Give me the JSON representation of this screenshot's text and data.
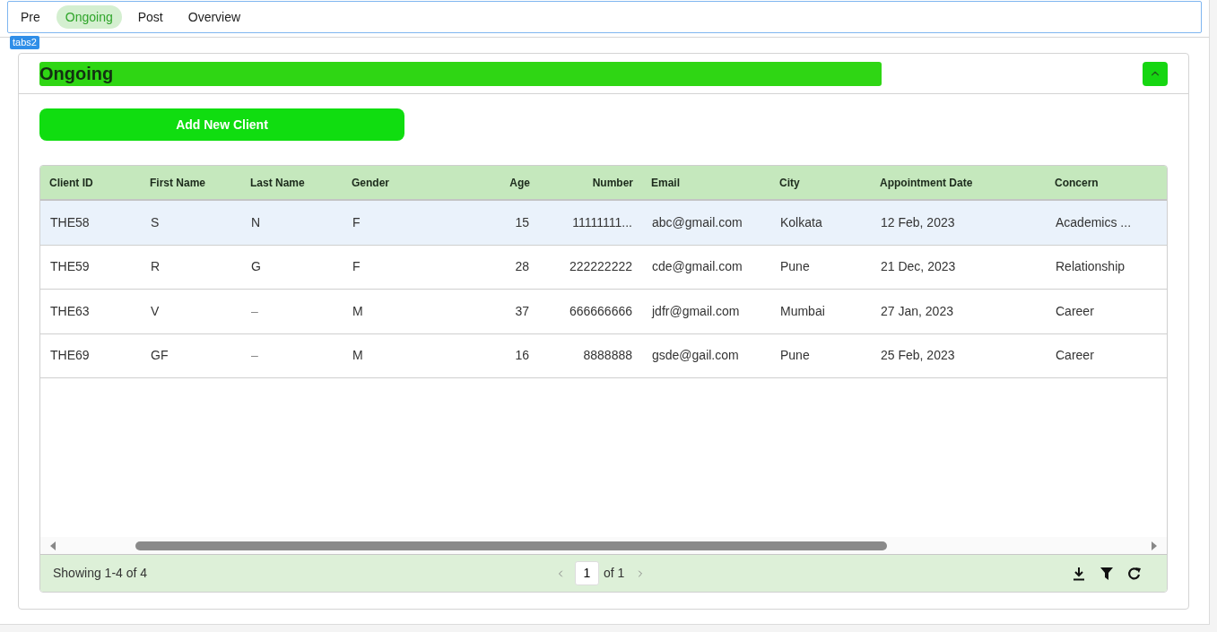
{
  "tabs": [
    {
      "label": "Pre",
      "selected": false
    },
    {
      "label": "Ongoing",
      "selected": true
    },
    {
      "label": "Post",
      "selected": false
    },
    {
      "label": "Overview",
      "selected": false
    }
  ],
  "editor_tag": "tabs2",
  "section": {
    "title": "Ongoing",
    "expanded": true
  },
  "add_button": "Add New Client",
  "table": {
    "columns": [
      {
        "label": "Client ID",
        "kind": "text"
      },
      {
        "label": "First Name",
        "kind": "text"
      },
      {
        "label": "Last Name",
        "kind": "text"
      },
      {
        "label": "Gender",
        "kind": "text"
      },
      {
        "label": "Age",
        "kind": "number"
      },
      {
        "label": "Number",
        "kind": "number"
      },
      {
        "label": "Email",
        "kind": "text"
      },
      {
        "label": "City",
        "kind": "text"
      },
      {
        "label": "Appointment Date",
        "kind": "text"
      },
      {
        "label": "Concern",
        "kind": "text"
      }
    ],
    "rows": [
      {
        "selected": true,
        "cells": [
          "THE58",
          "S",
          "N",
          "F",
          "15",
          "11111111...",
          "abc@gmail.com",
          "Kolkata",
          "12 Feb, 2023",
          "Academics ..."
        ]
      },
      {
        "selected": false,
        "cells": [
          "THE59",
          "R",
          "G",
          "F",
          "28",
          "222222222",
          "cde@gmail.com",
          "Pune",
          "21 Dec, 2023",
          "Relationship"
        ]
      },
      {
        "selected": false,
        "cells": [
          "THE63",
          "V",
          "–",
          "M",
          "37",
          "666666666",
          "jdfr@gmail.com",
          "Mumbai",
          "27 Jan, 2023",
          "Career"
        ]
      },
      {
        "selected": false,
        "cells": [
          "THE69",
          "GF",
          "–",
          "M",
          "16",
          "8888888",
          "gsde@gail.com",
          "Pune",
          "25 Feb, 2023",
          "Career"
        ]
      }
    ]
  },
  "footer": {
    "summary": "Showing 1-4 of 4",
    "page": "1",
    "of_pages": "of 1"
  }
}
